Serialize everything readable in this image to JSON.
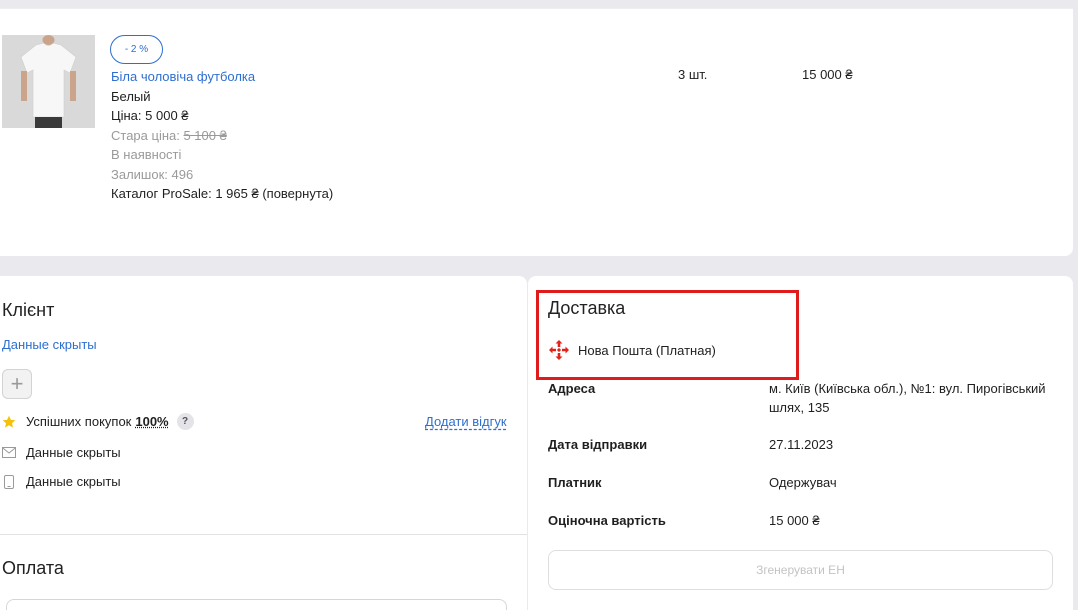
{
  "product": {
    "discount_badge": "- 2 %",
    "name": "Біла чоловіча футболка",
    "color": "Белый",
    "price": "Ціна: 5 000 ₴",
    "old_price_label": "Стара ціна: ",
    "old_price_value": "5 100 ₴",
    "availability": "В наявності",
    "stock": "Залишок: 496",
    "catalog": "Каталог ProSale: 1 965 ₴ (повернута)",
    "quantity": "3 шт.",
    "total": "15 000 ₴"
  },
  "client": {
    "title": "Клієнт",
    "hidden_link": "Данные скрыты",
    "add_symbol": "+",
    "success_label": "Успішних покупок",
    "success_value": "100%",
    "help_symbol": "?",
    "review_link": "Додати відгук",
    "email": "Данные скрыты",
    "phone": "Данные скрыты"
  },
  "payment": {
    "title": "Оплата"
  },
  "delivery": {
    "title": "Доставка",
    "carrier": "Нова Пошта (Платная)",
    "rows": [
      {
        "label": "Адреса",
        "value": "м. Київ (Київська обл.), №1: вул. Пирогівський шлях, 135"
      },
      {
        "label": "Дата відправки",
        "value": "27.11.2023"
      },
      {
        "label": "Платник",
        "value": "Одержувач"
      },
      {
        "label": "Оціночна вартість",
        "value": "15 000 ₴"
      }
    ],
    "generate_button": "Згенерувати ЕН"
  },
  "colors": {
    "link": "#2d6fd0",
    "highlight": "#e01b1b",
    "background": "#e9e9ee",
    "star": "#f4c20d",
    "carrier_logo": "#e2231a"
  },
  "icons": {
    "success": "star-icon",
    "email": "mail-icon",
    "phone": "phone-icon",
    "carrier": "nova-poshta-logo-icon"
  }
}
